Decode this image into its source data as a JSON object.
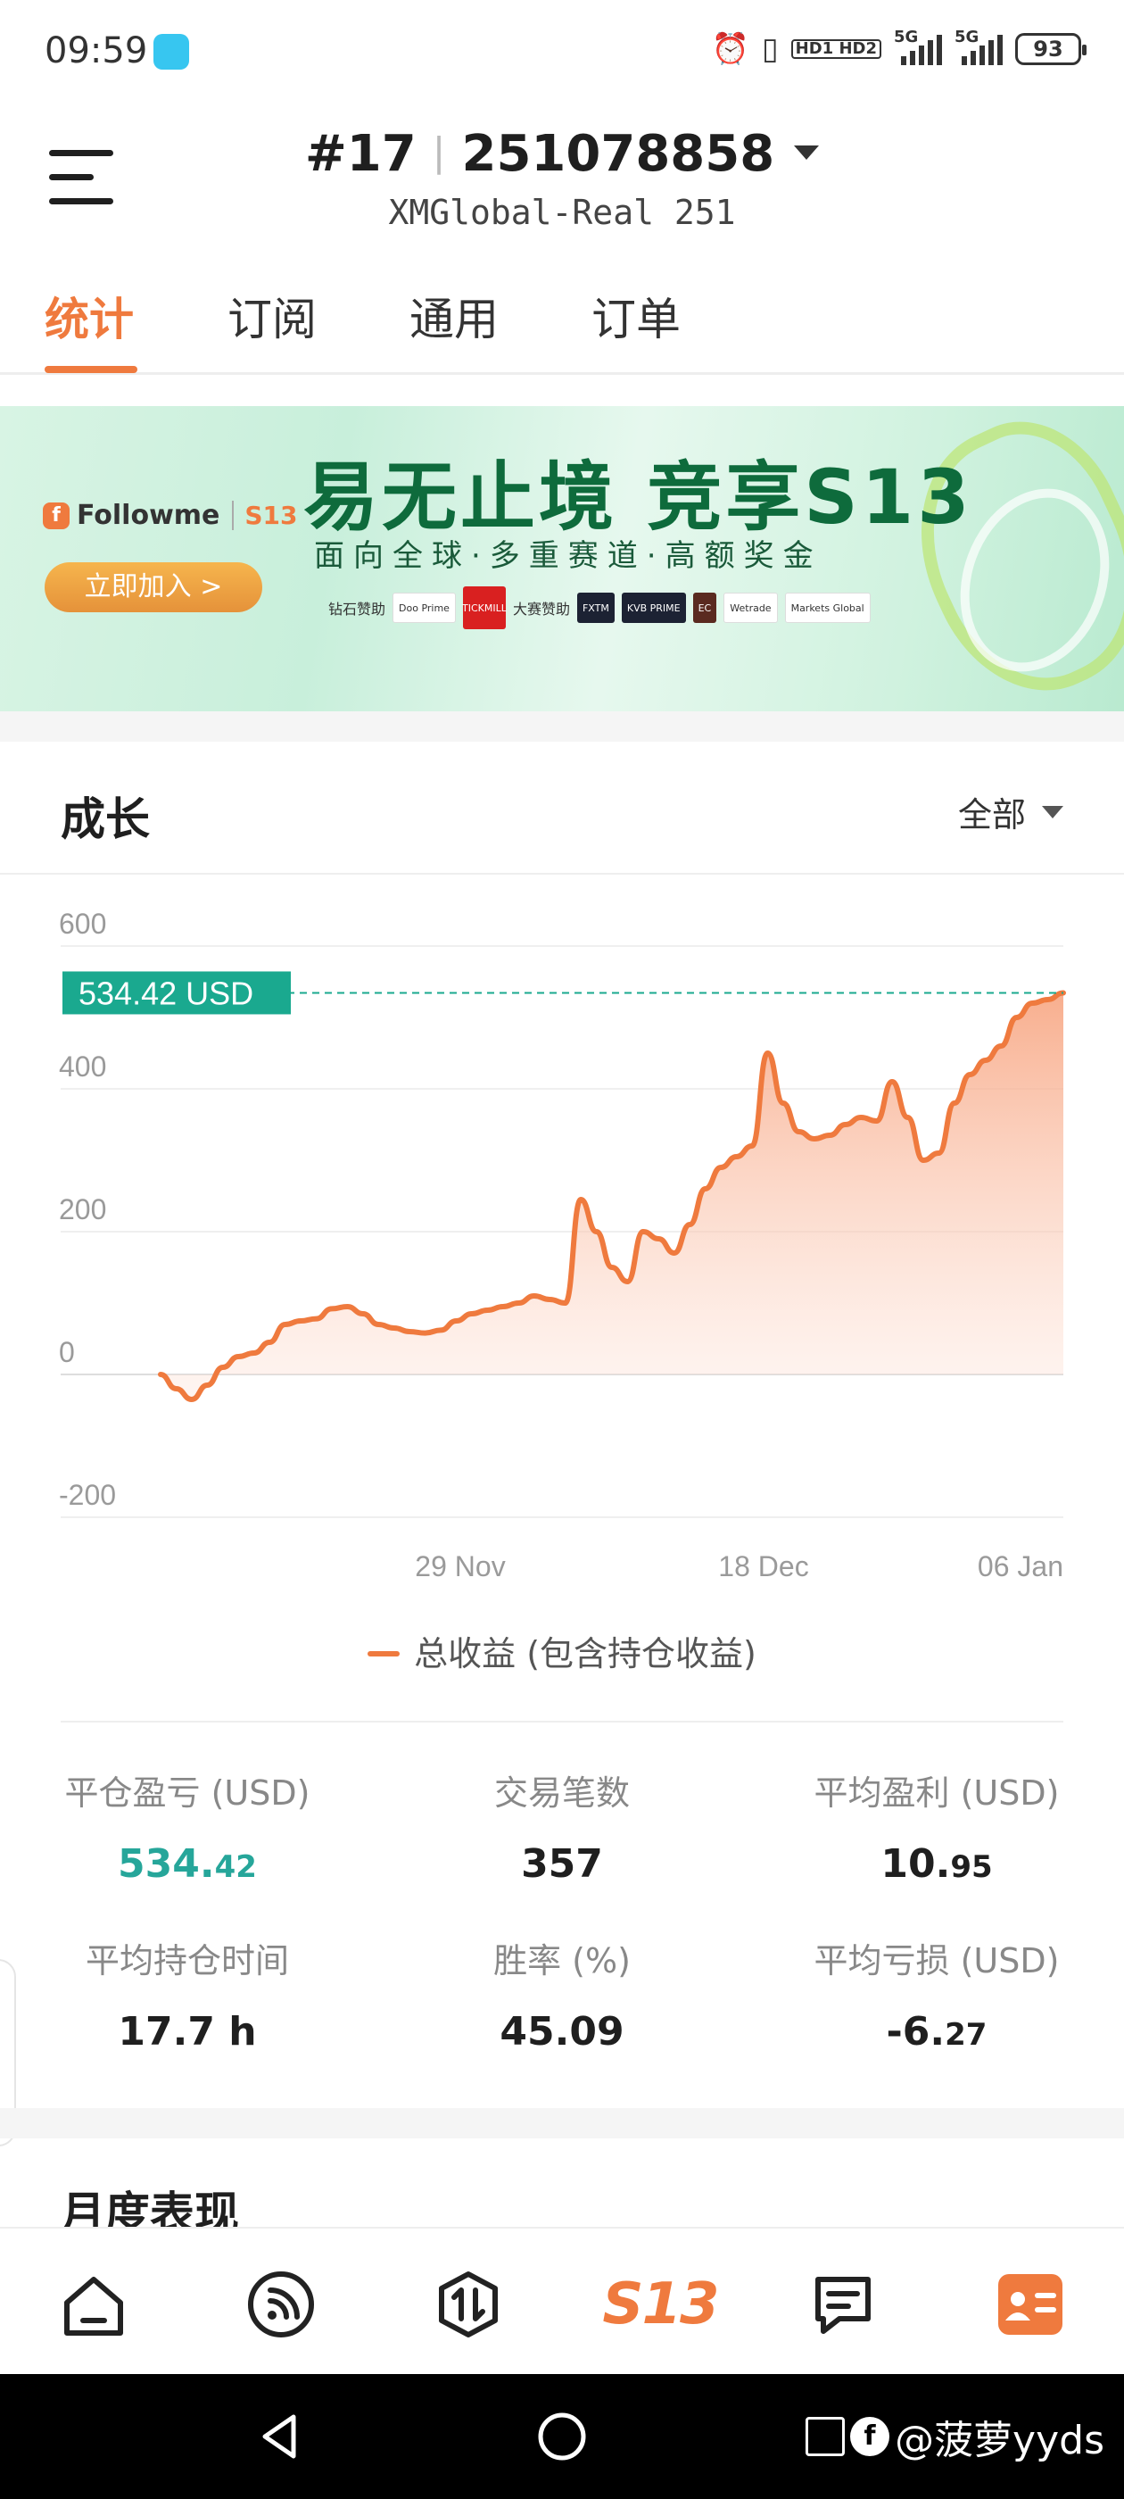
{
  "status_bar": {
    "time": "09:59",
    "network_1": "5G",
    "network_2": "5G",
    "hd_badge": "HD1 HD2",
    "battery": "93"
  },
  "header": {
    "rank": "#17",
    "account_id": "251078858",
    "server": "XMGlobal-Real 251"
  },
  "tabs": [
    {
      "label": "统计",
      "active": true
    },
    {
      "label": "订阅",
      "active": false
    },
    {
      "label": "通用",
      "active": false
    },
    {
      "label": "订单",
      "active": false
    }
  ],
  "banner": {
    "brand": "Followme",
    "brand_tag": "S13",
    "title": "易无止境 竞享S13",
    "subtitle": "面向全球·多重赛道·高额奖金",
    "cta": "立即加入 >",
    "sponsor_label_1": "钻石赞助",
    "sponsor_label_2": "大赛赞助",
    "sponsors": [
      "Doo Prime",
      "TICKMILL",
      "FXTM",
      "KVB PRIME",
      "EC",
      "Wetrade",
      "Markets Global"
    ]
  },
  "growth": {
    "title": "成长",
    "filter": "全部"
  },
  "chart_data": {
    "type": "area",
    "current_value_label": "534.42 USD",
    "y_ticks": [
      "600",
      "400",
      "200",
      "0",
      "-200"
    ],
    "x_ticks": [
      "29 Nov",
      "18 Dec",
      "06 Jan"
    ],
    "ylim": [
      -200,
      600
    ],
    "series": [
      {
        "name": "总收益 (包含持仓收益)",
        "color": "#ef7a3e",
        "values": [
          0,
          -20,
          -35,
          -15,
          10,
          25,
          30,
          45,
          70,
          75,
          78,
          92,
          95,
          85,
          70,
          65,
          60,
          58,
          62,
          75,
          85,
          90,
          95,
          100,
          110,
          105,
          100,
          245,
          200,
          150,
          130,
          200,
          190,
          170,
          210,
          260,
          290,
          305,
          320,
          450,
          380,
          340,
          330,
          335,
          350,
          360,
          355,
          410,
          360,
          300,
          310,
          380,
          420,
          440,
          460,
          500,
          520,
          525,
          534.42
        ]
      }
    ]
  },
  "stats": [
    {
      "label": "平仓盈亏 (USD)",
      "value_main": "534.",
      "value_small": "42",
      "accent": true
    },
    {
      "label": "交易笔数",
      "value_main": "357",
      "value_small": "",
      "accent": false
    },
    {
      "label": "平均盈利 (USD)",
      "value_main": "10.",
      "value_small": "95",
      "accent": false
    },
    {
      "label": "平均持仓时间",
      "value_main": "17.7 h",
      "value_small": "",
      "accent": false
    },
    {
      "label": "胜率 (%)",
      "value_main": "45.09",
      "value_small": "",
      "accent": false
    },
    {
      "label": "平均亏损 (USD)",
      "value_main": "-6.",
      "value_small": "27",
      "accent": false
    }
  ],
  "monthly": {
    "title": "月度表现"
  },
  "bottom_nav": {
    "s13_label": "S13"
  },
  "watermark": "@菠萝yyds",
  "colors": {
    "accent": "#ef7a3e",
    "profit_green": "#26a69a",
    "label_bg": "#1aa98f"
  }
}
